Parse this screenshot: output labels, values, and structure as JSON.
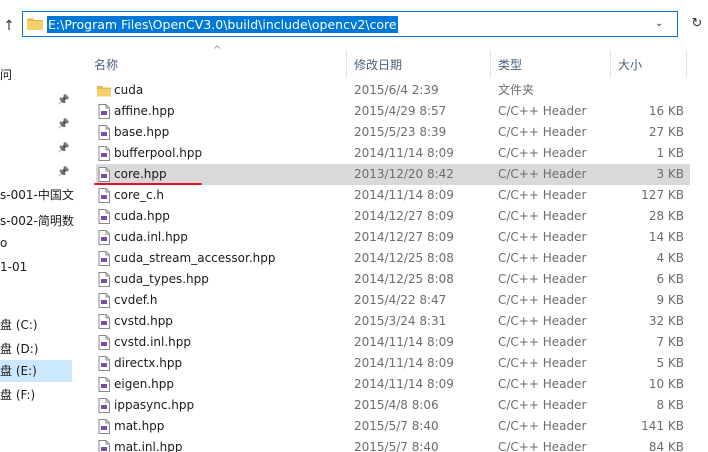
{
  "address_bar": {
    "path": "E:\\Program Files\\OpenCV3.0\\build\\include\\opencv2\\core"
  },
  "icons": {
    "up": "arrow-up-icon",
    "folder": "folder-icon",
    "file": "hpp-file-icon",
    "dropdown": "chevron-down-icon",
    "refresh": "refresh-icon",
    "pin": "pin-icon"
  },
  "nav": {
    "items": [
      {
        "label": "问",
        "pinned": false,
        "selected": false
      },
      {
        "label": "",
        "pinned": true,
        "selected": false
      },
      {
        "label": "",
        "pinned": true,
        "selected": false
      },
      {
        "label": "",
        "pinned": true,
        "selected": false
      },
      {
        "label": "",
        "pinned": true,
        "selected": false
      },
      {
        "label": "s-001-中国文",
        "pinned": false,
        "selected": false
      },
      {
        "label": "s-002-简明数",
        "pinned": false,
        "selected": false
      },
      {
        "label": "o",
        "pinned": false,
        "selected": false
      },
      {
        "label": "1-01",
        "pinned": false,
        "selected": false
      },
      {
        "label": "",
        "pinned": false,
        "selected": false
      },
      {
        "label": "盘 (C:)",
        "pinned": false,
        "selected": false
      },
      {
        "label": "盘 (D:)",
        "pinned": false,
        "selected": false
      },
      {
        "label": "盘 (E:)",
        "pinned": false,
        "selected": true
      },
      {
        "label": "盘 (F:)",
        "pinned": false,
        "selected": false
      }
    ]
  },
  "columns": {
    "name": "名称",
    "date": "修改日期",
    "type": "类型",
    "size": "大小"
  },
  "files": [
    {
      "name": "cuda",
      "date": "2015/6/4 2:39",
      "type": "文件夹",
      "size": "",
      "kind": "folder"
    },
    {
      "name": "affine.hpp",
      "date": "2015/4/29 8:57",
      "type": "C/C++ Header",
      "size": "16 KB",
      "kind": "file"
    },
    {
      "name": "base.hpp",
      "date": "2015/5/23 8:39",
      "type": "C/C++ Header",
      "size": "27 KB",
      "kind": "file"
    },
    {
      "name": "bufferpool.hpp",
      "date": "2014/11/14 8:09",
      "type": "C/C++ Header",
      "size": "1 KB",
      "kind": "file"
    },
    {
      "name": "core.hpp",
      "date": "2013/12/20 8:42",
      "type": "C/C++ Header",
      "size": "3 KB",
      "kind": "file",
      "selected": true
    },
    {
      "name": "core_c.h",
      "date": "2014/11/14 8:09",
      "type": "C/C++ Header",
      "size": "127 KB",
      "kind": "file"
    },
    {
      "name": "cuda.hpp",
      "date": "2014/12/27 8:09",
      "type": "C/C++ Header",
      "size": "28 KB",
      "kind": "file"
    },
    {
      "name": "cuda.inl.hpp",
      "date": "2014/12/27 8:09",
      "type": "C/C++ Header",
      "size": "14 KB",
      "kind": "file"
    },
    {
      "name": "cuda_stream_accessor.hpp",
      "date": "2014/12/25 8:08",
      "type": "C/C++ Header",
      "size": "4 KB",
      "kind": "file"
    },
    {
      "name": "cuda_types.hpp",
      "date": "2014/12/25 8:08",
      "type": "C/C++ Header",
      "size": "6 KB",
      "kind": "file"
    },
    {
      "name": "cvdef.h",
      "date": "2015/4/22 8:47",
      "type": "C/C++ Header",
      "size": "9 KB",
      "kind": "file"
    },
    {
      "name": "cvstd.hpp",
      "date": "2015/3/24 8:31",
      "type": "C/C++ Header",
      "size": "32 KB",
      "kind": "file"
    },
    {
      "name": "cvstd.inl.hpp",
      "date": "2014/11/14 8:09",
      "type": "C/C++ Header",
      "size": "7 KB",
      "kind": "file"
    },
    {
      "name": "directx.hpp",
      "date": "2014/11/14 8:09",
      "type": "C/C++ Header",
      "size": "5 KB",
      "kind": "file"
    },
    {
      "name": "eigen.hpp",
      "date": "2014/11/14 8:09",
      "type": "C/C++ Header",
      "size": "10 KB",
      "kind": "file"
    },
    {
      "name": "ippasync.hpp",
      "date": "2015/4/8 8:06",
      "type": "C/C++ Header",
      "size": "8 KB",
      "kind": "file"
    },
    {
      "name": "mat.hpp",
      "date": "2015/5/7 8:40",
      "type": "C/C++ Header",
      "size": "141 KB",
      "kind": "file"
    },
    {
      "name": "mat.inl.hpp",
      "date": "2015/5/7 8:40",
      "type": "C/C++ Header",
      "size": "84 KB",
      "kind": "file"
    }
  ],
  "colors": {
    "accent": "#0078d7",
    "selection_row": "#d9d9d9",
    "nav_selection": "#cce8ff",
    "folder": "#e8b84a",
    "annotation": "#e81123"
  }
}
